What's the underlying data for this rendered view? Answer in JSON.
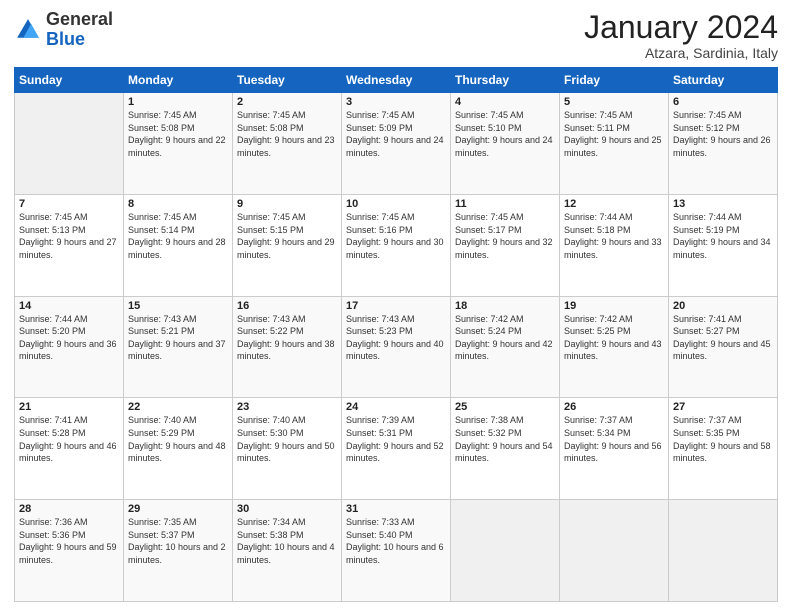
{
  "header": {
    "logo_general": "General",
    "logo_blue": "Blue",
    "month_title": "January 2024",
    "subtitle": "Atzara, Sardinia, Italy"
  },
  "weekdays": [
    "Sunday",
    "Monday",
    "Tuesday",
    "Wednesday",
    "Thursday",
    "Friday",
    "Saturday"
  ],
  "weeks": [
    [
      {
        "day": "",
        "sunrise": "",
        "sunset": "",
        "daylight": ""
      },
      {
        "day": "1",
        "sunrise": "Sunrise: 7:45 AM",
        "sunset": "Sunset: 5:08 PM",
        "daylight": "Daylight: 9 hours and 22 minutes."
      },
      {
        "day": "2",
        "sunrise": "Sunrise: 7:45 AM",
        "sunset": "Sunset: 5:08 PM",
        "daylight": "Daylight: 9 hours and 23 minutes."
      },
      {
        "day": "3",
        "sunrise": "Sunrise: 7:45 AM",
        "sunset": "Sunset: 5:09 PM",
        "daylight": "Daylight: 9 hours and 24 minutes."
      },
      {
        "day": "4",
        "sunrise": "Sunrise: 7:45 AM",
        "sunset": "Sunset: 5:10 PM",
        "daylight": "Daylight: 9 hours and 24 minutes."
      },
      {
        "day": "5",
        "sunrise": "Sunrise: 7:45 AM",
        "sunset": "Sunset: 5:11 PM",
        "daylight": "Daylight: 9 hours and 25 minutes."
      },
      {
        "day": "6",
        "sunrise": "Sunrise: 7:45 AM",
        "sunset": "Sunset: 5:12 PM",
        "daylight": "Daylight: 9 hours and 26 minutes."
      }
    ],
    [
      {
        "day": "7",
        "sunrise": "Sunrise: 7:45 AM",
        "sunset": "Sunset: 5:13 PM",
        "daylight": "Daylight: 9 hours and 27 minutes."
      },
      {
        "day": "8",
        "sunrise": "Sunrise: 7:45 AM",
        "sunset": "Sunset: 5:14 PM",
        "daylight": "Daylight: 9 hours and 28 minutes."
      },
      {
        "day": "9",
        "sunrise": "Sunrise: 7:45 AM",
        "sunset": "Sunset: 5:15 PM",
        "daylight": "Daylight: 9 hours and 29 minutes."
      },
      {
        "day": "10",
        "sunrise": "Sunrise: 7:45 AM",
        "sunset": "Sunset: 5:16 PM",
        "daylight": "Daylight: 9 hours and 30 minutes."
      },
      {
        "day": "11",
        "sunrise": "Sunrise: 7:45 AM",
        "sunset": "Sunset: 5:17 PM",
        "daylight": "Daylight: 9 hours and 32 minutes."
      },
      {
        "day": "12",
        "sunrise": "Sunrise: 7:44 AM",
        "sunset": "Sunset: 5:18 PM",
        "daylight": "Daylight: 9 hours and 33 minutes."
      },
      {
        "day": "13",
        "sunrise": "Sunrise: 7:44 AM",
        "sunset": "Sunset: 5:19 PM",
        "daylight": "Daylight: 9 hours and 34 minutes."
      }
    ],
    [
      {
        "day": "14",
        "sunrise": "Sunrise: 7:44 AM",
        "sunset": "Sunset: 5:20 PM",
        "daylight": "Daylight: 9 hours and 36 minutes."
      },
      {
        "day": "15",
        "sunrise": "Sunrise: 7:43 AM",
        "sunset": "Sunset: 5:21 PM",
        "daylight": "Daylight: 9 hours and 37 minutes."
      },
      {
        "day": "16",
        "sunrise": "Sunrise: 7:43 AM",
        "sunset": "Sunset: 5:22 PM",
        "daylight": "Daylight: 9 hours and 38 minutes."
      },
      {
        "day": "17",
        "sunrise": "Sunrise: 7:43 AM",
        "sunset": "Sunset: 5:23 PM",
        "daylight": "Daylight: 9 hours and 40 minutes."
      },
      {
        "day": "18",
        "sunrise": "Sunrise: 7:42 AM",
        "sunset": "Sunset: 5:24 PM",
        "daylight": "Daylight: 9 hours and 42 minutes."
      },
      {
        "day": "19",
        "sunrise": "Sunrise: 7:42 AM",
        "sunset": "Sunset: 5:25 PM",
        "daylight": "Daylight: 9 hours and 43 minutes."
      },
      {
        "day": "20",
        "sunrise": "Sunrise: 7:41 AM",
        "sunset": "Sunset: 5:27 PM",
        "daylight": "Daylight: 9 hours and 45 minutes."
      }
    ],
    [
      {
        "day": "21",
        "sunrise": "Sunrise: 7:41 AM",
        "sunset": "Sunset: 5:28 PM",
        "daylight": "Daylight: 9 hours and 46 minutes."
      },
      {
        "day": "22",
        "sunrise": "Sunrise: 7:40 AM",
        "sunset": "Sunset: 5:29 PM",
        "daylight": "Daylight: 9 hours and 48 minutes."
      },
      {
        "day": "23",
        "sunrise": "Sunrise: 7:40 AM",
        "sunset": "Sunset: 5:30 PM",
        "daylight": "Daylight: 9 hours and 50 minutes."
      },
      {
        "day": "24",
        "sunrise": "Sunrise: 7:39 AM",
        "sunset": "Sunset: 5:31 PM",
        "daylight": "Daylight: 9 hours and 52 minutes."
      },
      {
        "day": "25",
        "sunrise": "Sunrise: 7:38 AM",
        "sunset": "Sunset: 5:32 PM",
        "daylight": "Daylight: 9 hours and 54 minutes."
      },
      {
        "day": "26",
        "sunrise": "Sunrise: 7:37 AM",
        "sunset": "Sunset: 5:34 PM",
        "daylight": "Daylight: 9 hours and 56 minutes."
      },
      {
        "day": "27",
        "sunrise": "Sunrise: 7:37 AM",
        "sunset": "Sunset: 5:35 PM",
        "daylight": "Daylight: 9 hours and 58 minutes."
      }
    ],
    [
      {
        "day": "28",
        "sunrise": "Sunrise: 7:36 AM",
        "sunset": "Sunset: 5:36 PM",
        "daylight": "Daylight: 9 hours and 59 minutes."
      },
      {
        "day": "29",
        "sunrise": "Sunrise: 7:35 AM",
        "sunset": "Sunset: 5:37 PM",
        "daylight": "Daylight: 10 hours and 2 minutes."
      },
      {
        "day": "30",
        "sunrise": "Sunrise: 7:34 AM",
        "sunset": "Sunset: 5:38 PM",
        "daylight": "Daylight: 10 hours and 4 minutes."
      },
      {
        "day": "31",
        "sunrise": "Sunrise: 7:33 AM",
        "sunset": "Sunset: 5:40 PM",
        "daylight": "Daylight: 10 hours and 6 minutes."
      },
      {
        "day": "",
        "sunrise": "",
        "sunset": "",
        "daylight": ""
      },
      {
        "day": "",
        "sunrise": "",
        "sunset": "",
        "daylight": ""
      },
      {
        "day": "",
        "sunrise": "",
        "sunset": "",
        "daylight": ""
      }
    ]
  ]
}
